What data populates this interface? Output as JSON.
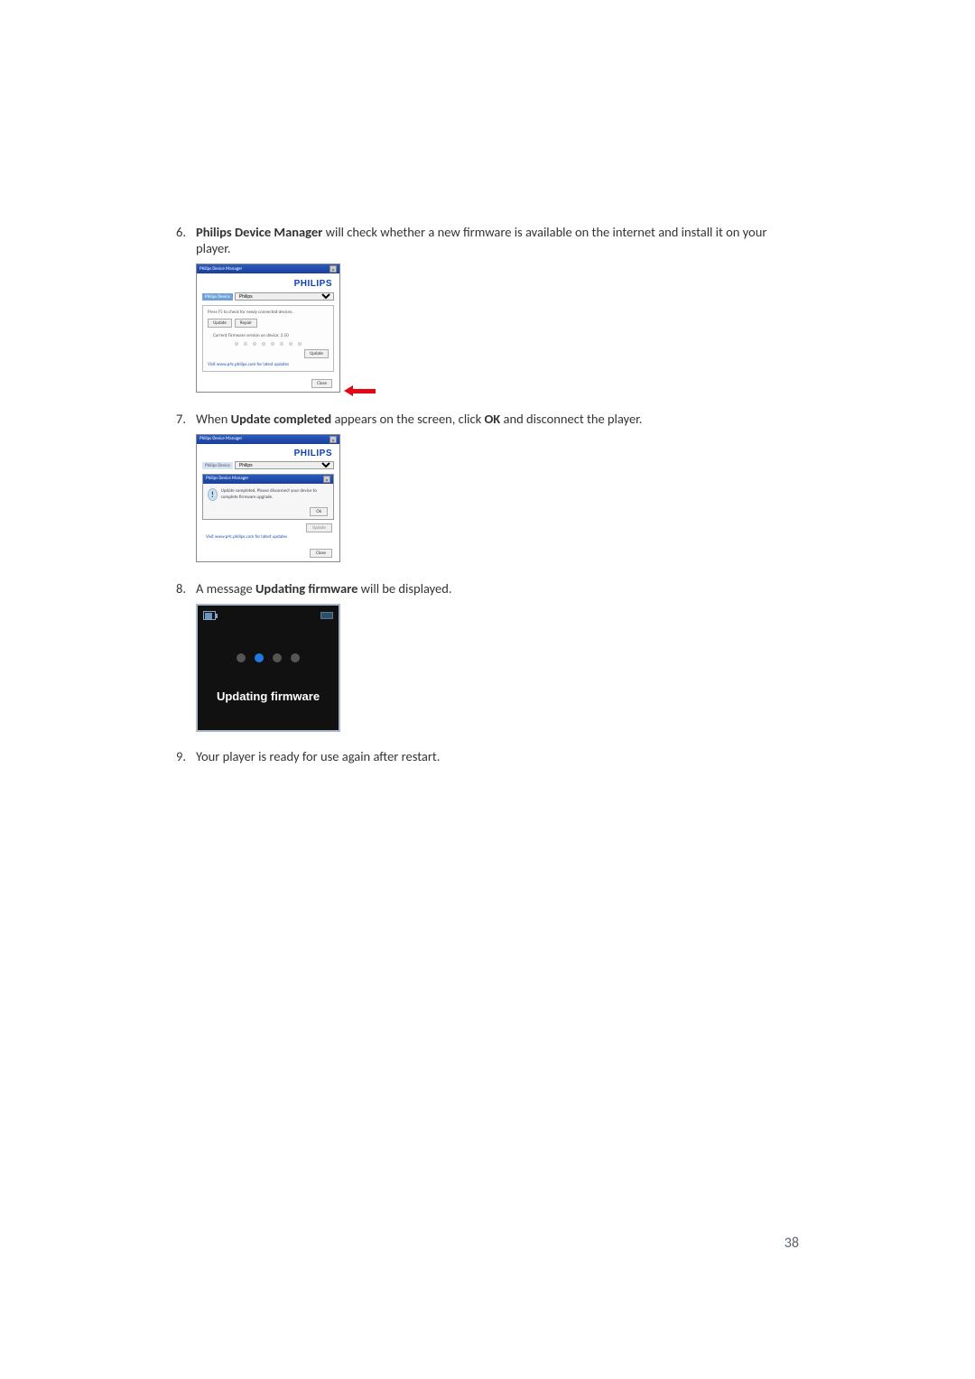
{
  "steps": {
    "s6": {
      "num": "6.",
      "text_before": "Philips Device Manager",
      "text_after": " will check whether a new firmware is available on the internet and install it on your player."
    },
    "s7": {
      "num": "7.",
      "prefix": "When ",
      "bold1": "Update completed",
      "mid": " appears on the screen, click ",
      "bold2": "OK",
      "suffix": " and disconnect the player."
    },
    "s8": {
      "num": "8.",
      "prefix": "A message ",
      "bold1": "Updating firmware",
      "suffix": " will be displayed."
    },
    "s9": {
      "num": "9.",
      "text": "Your player is ready for use again after restart."
    }
  },
  "fig1": {
    "title": "Philips Device Manager",
    "logo": "PHILIPS",
    "dev_label": "Philips Device",
    "device": "Philips",
    "hint": "Press F5 to check for newly connected devices.",
    "btn_update": "Update",
    "btn_repair": "Repair",
    "fw_line": "Current Firmware version on device: 2.50",
    "update_btn": "Update",
    "link": "Visit www.p4c.philips.com for latest updates",
    "close": "Close"
  },
  "fig2": {
    "title": "Philips Device Manager",
    "logo": "PHILIPS",
    "dev_label": "Philips Device",
    "device": "Philips",
    "popup_title": "Philips Device Manager",
    "popup_msg": "Update completed. Please disconnect your device to complete firmware upgrade.",
    "ok": "Ok",
    "update_btn": "Update",
    "link": "Visit www.p4c.philips.com for latest updates",
    "close": "Close"
  },
  "fig3": {
    "text": "Updating firmware"
  },
  "page_number": "38"
}
